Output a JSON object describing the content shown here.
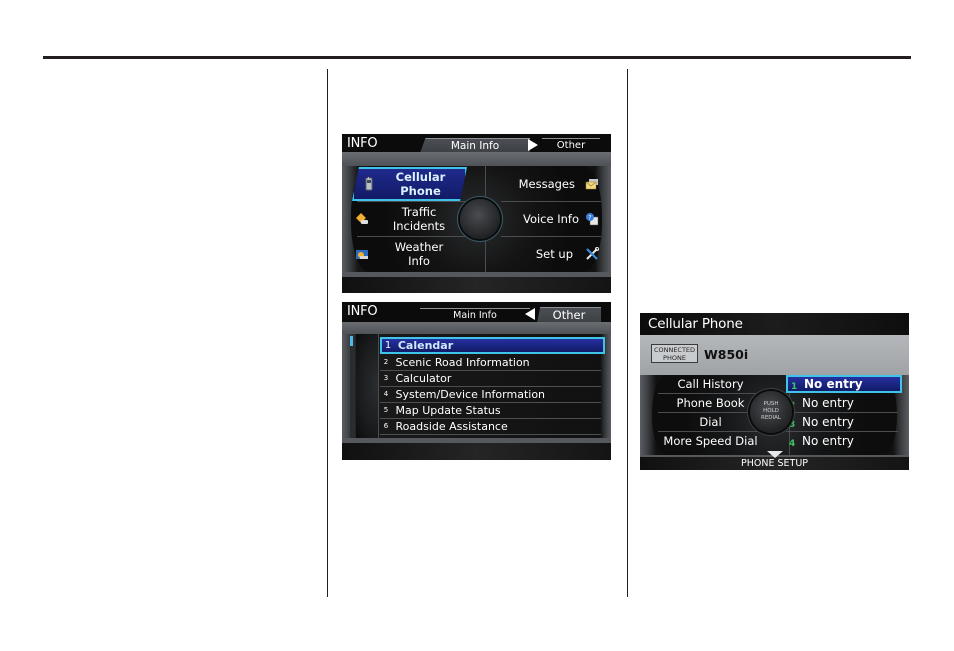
{
  "page": {
    "rule_color": "#231f20"
  },
  "screen_main_info": {
    "title": "INFO",
    "tabs": [
      {
        "label": "Main Info",
        "active": true
      },
      {
        "label": "Other",
        "active": false
      }
    ],
    "tab_arrow": "right-arrow-icon",
    "menu_items": [
      {
        "label_line1": "Cellular",
        "label_line2": "Phone",
        "icon": "cellphone-icon",
        "selected": true
      },
      {
        "label_line1": "Traffic",
        "label_line2": "Incidents",
        "icon": "traffic-warning-icon",
        "selected": false
      },
      {
        "label_line1": "Weather",
        "label_line2": "Info",
        "icon": "weather-icon",
        "selected": false
      },
      {
        "label_line1": "Messages",
        "label_line2": "",
        "icon": "envelope-icon",
        "selected": false
      },
      {
        "label_line1": "Voice Info",
        "label_line2": "",
        "icon": "voice-help-icon",
        "selected": false
      },
      {
        "label_line1": "Set up",
        "label_line2": "",
        "icon": "wrench-screwdriver-icon",
        "selected": false
      }
    ]
  },
  "screen_other": {
    "title": "INFO",
    "tabs": [
      {
        "label": "Main Info",
        "active": false
      },
      {
        "label": "Other",
        "active": true
      }
    ],
    "tab_arrow": "left-arrow-icon",
    "list_items": [
      {
        "num": "1",
        "label": "Calendar",
        "selected": true
      },
      {
        "num": "2",
        "label": "Scenic Road Information",
        "selected": false
      },
      {
        "num": "3",
        "label": "Calculator",
        "selected": false
      },
      {
        "num": "4",
        "label": "System/Device Information",
        "selected": false
      },
      {
        "num": "5",
        "label": "Map Update Status",
        "selected": false
      },
      {
        "num": "6",
        "label": "Roadside Assistance",
        "selected": false
      }
    ]
  },
  "screen_cellular": {
    "title": "Cellular Phone",
    "connected_badge_line1": "CONNECTED",
    "connected_badge_line2": "PHONE",
    "device_name": "W850i",
    "left_items": [
      "Call History",
      "Phone Book",
      "Dial",
      "More Speed Dial"
    ],
    "speed_dials": [
      {
        "slot": "1",
        "label": "No entry",
        "selected": true
      },
      {
        "slot": "2",
        "label": "No entry",
        "selected": false
      },
      {
        "slot": "3",
        "label": "No entry",
        "selected": false
      },
      {
        "slot": "4",
        "label": "No entry",
        "selected": false
      }
    ],
    "knob_line1": "PUSH",
    "knob_line2": "HOLD",
    "knob_line3": "REDIAL",
    "footer": "PHONE SETUP",
    "accent_color": "#3fc3e8",
    "speed_dial_icon_color": "#40c060"
  }
}
